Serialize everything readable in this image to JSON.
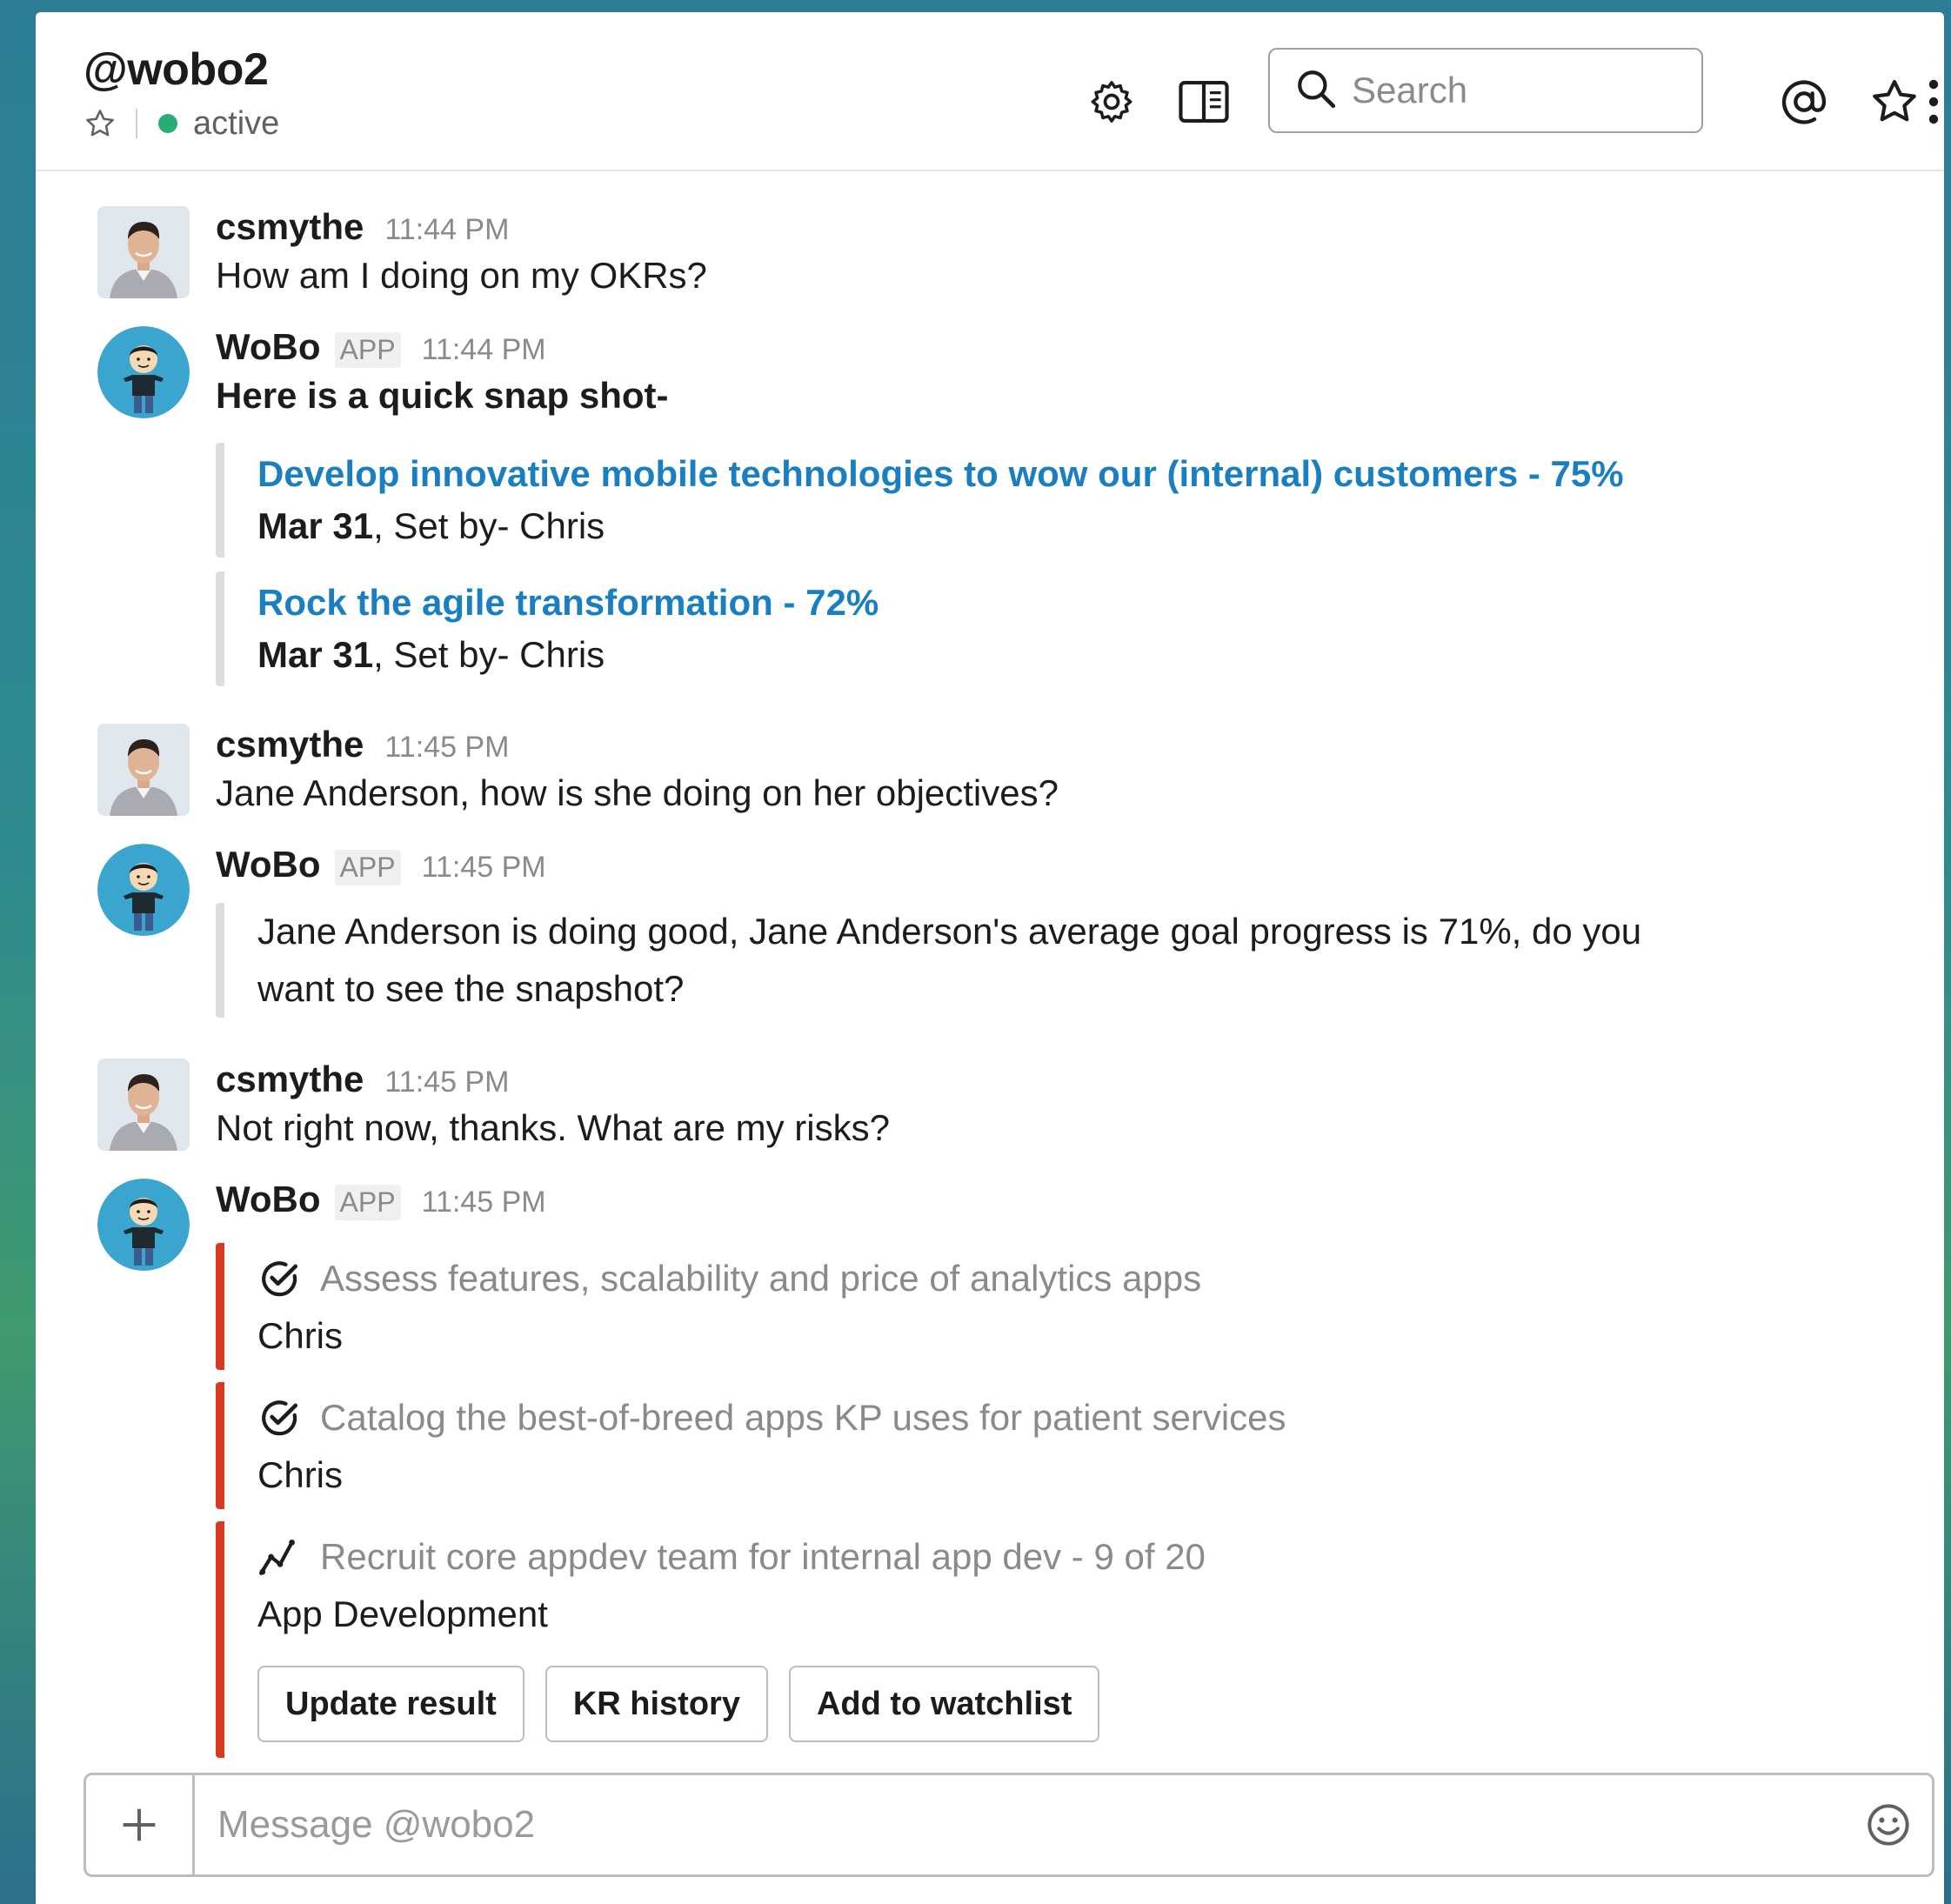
{
  "header": {
    "channel_title": "@wobo2",
    "status": "active",
    "search_placeholder": "Search"
  },
  "messages": [
    {
      "sender": "csmythe",
      "time": "11:44 PM",
      "text": "How am I doing on my OKRs?"
    },
    {
      "sender": "WoBo",
      "badge": "APP",
      "time": "11:44 PM",
      "text": "Here is a quick snap shot-",
      "attachments": [
        {
          "link": "Develop innovative mobile technologies to wow our (internal) customers - 75%",
          "date": "Mar 31",
          "set_by": ", Set by- Chris"
        },
        {
          "link": "Rock the agile transformation - 72%",
          "date": "Mar 31",
          "set_by": ", Set by- Chris"
        }
      ]
    },
    {
      "sender": "csmythe",
      "time": "11:45 PM",
      "text": "Jane Anderson, how is she doing on her objectives?"
    },
    {
      "sender": "WoBo",
      "badge": "APP",
      "time": "11:45 PM",
      "attachment_text": "Jane Anderson is doing good, Jane Anderson's average goal progress is 71%, do you want to see the snapshot?"
    },
    {
      "sender": "csmythe",
      "time": "11:45 PM",
      "text": "Not right now, thanks. What are my risks?"
    },
    {
      "sender": "WoBo",
      "badge": "APP",
      "time": "11:45 PM",
      "risks": [
        {
          "icon": "check-circle-icon",
          "title": "Assess features, scalability and price of analytics apps",
          "owner": "Chris"
        },
        {
          "icon": "check-circle-icon",
          "title": "Catalog the best-of-breed apps KP uses for patient services",
          "owner": "Chris"
        },
        {
          "icon": "trend-line-icon",
          "title": "Recruit core appdev team for internal app dev - 9 of 20",
          "owner": "App Development"
        }
      ],
      "actions": {
        "update": "Update result",
        "history": "KR history",
        "watchlist": "Add to watchlist"
      }
    }
  ],
  "composer": {
    "placeholder": "Message @wobo2"
  },
  "colors": {
    "link": "#1a7fc1",
    "danger_bar": "#d73a1e",
    "presence": "#2bac76"
  }
}
